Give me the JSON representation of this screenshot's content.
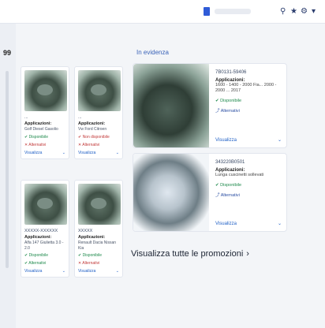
{
  "browser": {
    "lang": "ITA",
    "icons": [
      "user-icon",
      "star-icon",
      "cart-icon",
      "menu-icon"
    ]
  },
  "left_mark": "99",
  "section": {
    "title": "In evidenza"
  },
  "small_cards": [
    {
      "code": "...",
      "title": "Applicazioni:",
      "desc": "Golf Diesel Gasolio",
      "status_ok": "✔ Disponibile",
      "status_ko": "✕ Alternativi",
      "link": "Visualizza"
    },
    {
      "code": "...",
      "title": "Applicazioni:",
      "desc": "Vw Ford Citroen",
      "status_ok": "✔ Non disponibile",
      "status_ko": "✕ Alternativi",
      "link": "Visualizza"
    },
    {
      "code": "XXXXX-XXXXXX",
      "title": "Applicazioni:",
      "desc": "Alfa 147 Giulietta 3.0 - 2.0",
      "status_ok": "✔ Disponibile",
      "status_ko": "✔ Alternativi",
      "link": "Visualizza"
    },
    {
      "code": "XXXXX",
      "title": "Applicazioni:",
      "desc": "Renault Dacia Nissan Kia",
      "status_ok": "✔ Disponibile",
      "status_ko": "✕ Alternativi",
      "link": "Visualizza"
    }
  ],
  "big_cards": [
    {
      "code": "7B0131-59406",
      "title": "Applicazioni:",
      "desc": "1600 - 1400 - 2000 Fia... 2000 - 2000 ... 2017",
      "status_ok": "✔ Disponibile",
      "status_alt": "⤴ Alternativi",
      "link": "Visualizza"
    },
    {
      "code": "343220B0501",
      "title": "Applicazioni:",
      "desc": "Lunga cuscinetti sollevati",
      "status_ok": "✔ Disponibile",
      "status_alt": "⤴ Alternativi",
      "link": "Visualizza"
    }
  ],
  "promo_link": "Visualizza tutte le promozioni",
  "colors": {
    "accent": "#3a63b8",
    "available": "#1f8a4c",
    "unavailable": "#c23a3a"
  }
}
